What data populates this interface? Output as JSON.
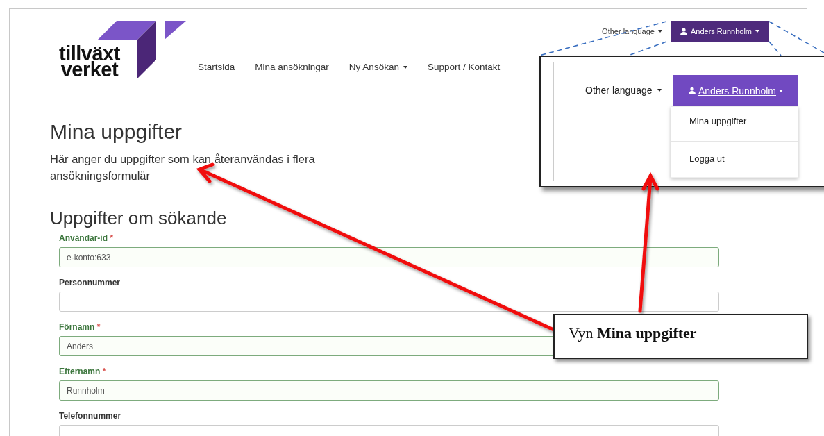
{
  "logo": {
    "line1": "tillväxt",
    "line2": "verket"
  },
  "nav": [
    {
      "label": "Startsida",
      "dropdown": false
    },
    {
      "label": "Mina ansökningar",
      "dropdown": false
    },
    {
      "label": "Ny Ansökan",
      "dropdown": true
    },
    {
      "label": "Support / Kontakt",
      "dropdown": false
    }
  ],
  "top_bar": {
    "language": "Other language",
    "user": "Anders Runnholm"
  },
  "page": {
    "title": "Mina uppgifter",
    "intro": "Här anger du uppgifter som kan återanvändas i flera ansökningsformulär",
    "section": "Uppgifter om sökande"
  },
  "fields": [
    {
      "label": "Användar-id",
      "marker": "*",
      "valid": true,
      "value": "e-konto:633"
    },
    {
      "label": "Personnummer",
      "valid": false
    },
    {
      "label": "Förnamn",
      "marker": "*",
      "valid": true,
      "value": "Anders"
    },
    {
      "label": "Efternamn",
      "marker": "*",
      "valid": true,
      "value": "Runnholm"
    },
    {
      "label": "Telefonnummer",
      "valid": false
    }
  ],
  "callout_zoom": {
    "language": "Other language",
    "user": "Anders Runnholm",
    "menu": [
      {
        "label": "Mina uppgifter"
      },
      {
        "label": "Logga ut"
      }
    ]
  },
  "annotation": {
    "text": "Vyn **Mina uppgifter**"
  }
}
